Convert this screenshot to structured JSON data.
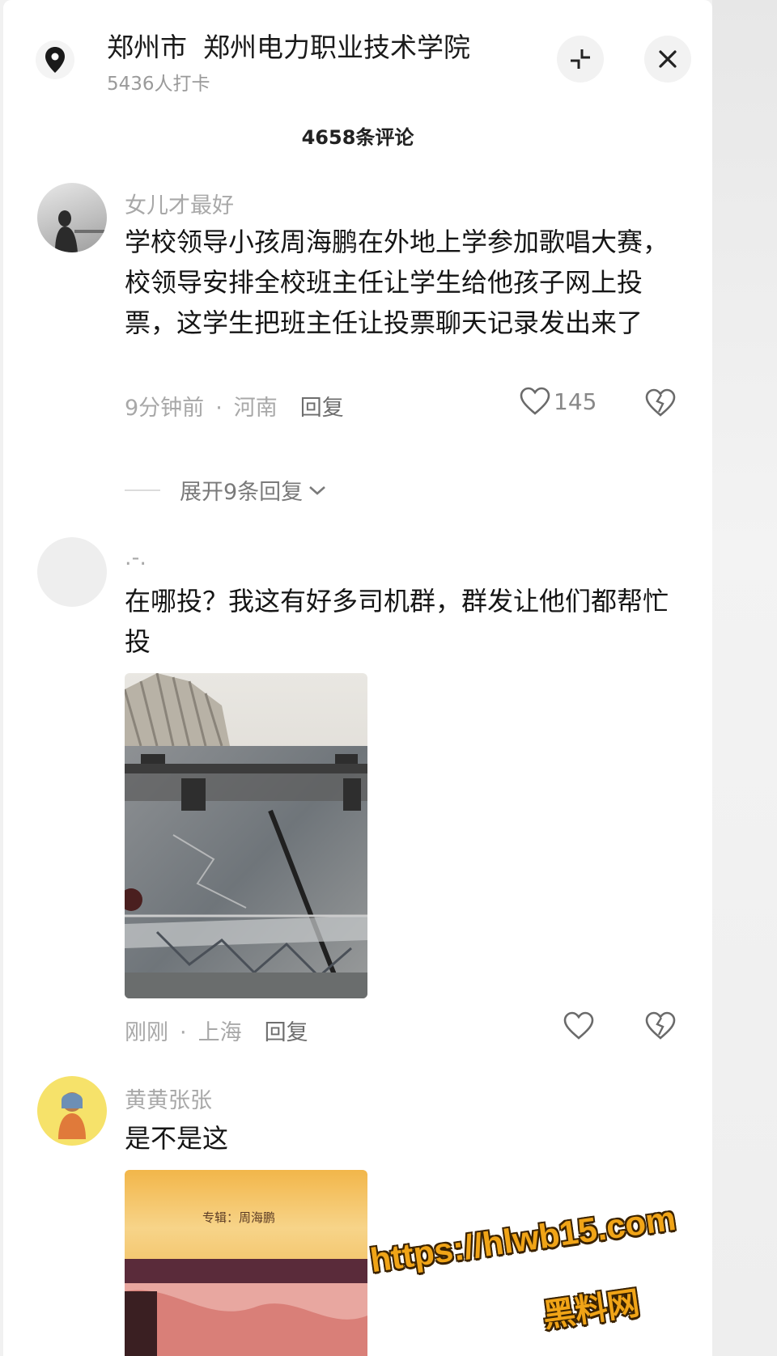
{
  "header": {
    "city": "郑州市",
    "place": "郑州电力职业技术学院",
    "checkins": "5436人打卡",
    "location_icon": "location-pin-icon",
    "collapse_icon": "collapse-icon",
    "close_icon": "close-icon"
  },
  "comment_count": "4658条评论",
  "comments": [
    {
      "username": "女儿才最好",
      "text": "学校领导小孩周海鹏在外地上学参加歌唱大赛，校领导安排全校班主任让学生给他孩子网上投票，这学生把班主任让投票聊天记录发出来了",
      "time": "9分钟前",
      "location": "河南",
      "reply_label": "回复",
      "likes": "145",
      "expand_label": "展开9条回复"
    },
    {
      "username": ".-.",
      "text": "在哪投？我这有好多司机群，群发让他们都帮忙投",
      "time": "刚刚",
      "location": "上海",
      "reply_label": "回复",
      "likes": ""
    },
    {
      "username": "黄黄张张",
      "text": "是不是这",
      "image_caption": "专辑：周海鹏"
    }
  ],
  "watermark": {
    "url": "https://hlwb15.com",
    "site": "黑料网"
  },
  "colors": {
    "text_primary": "#151515",
    "text_secondary": "#a8a8a8",
    "watermark": "#f0a417"
  }
}
